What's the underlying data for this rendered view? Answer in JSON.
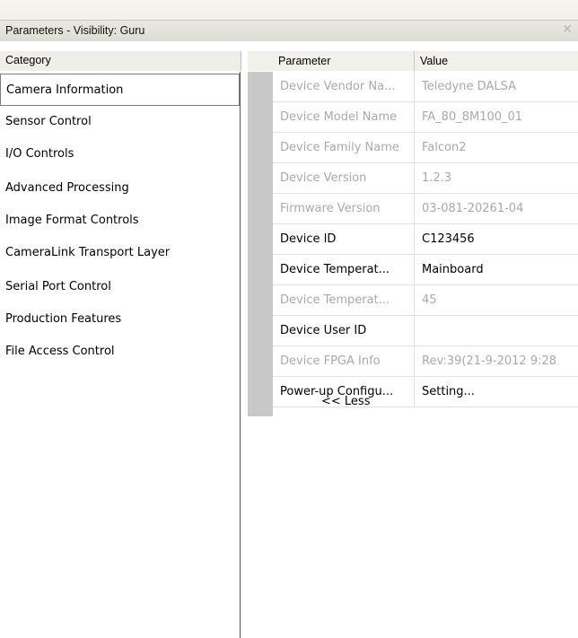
{
  "window": {
    "title": "Parameters - Visibility: Guru",
    "close_glyph": "✕"
  },
  "category_panel": {
    "header": "Category",
    "items": [
      "Camera Information",
      "Sensor Control",
      "I/O Controls",
      "Advanced Processing",
      "Image Format Controls",
      "CameraLink Transport Layer",
      "Serial Port Control",
      "Production Features",
      "File Access Control"
    ],
    "selected_index": 0
  },
  "parameter_grid": {
    "headers": [
      "Parameter",
      "Value"
    ],
    "rows": [
      {
        "parameter": "Device Vendor Na...",
        "value": "Teledyne DALSA",
        "enabled": false
      },
      {
        "parameter": "Device Model Name",
        "value": "FA_80_8M100_01",
        "enabled": false
      },
      {
        "parameter": "Device Family Name",
        "value": "Falcon2",
        "enabled": false
      },
      {
        "parameter": "Device Version",
        "value": "1.2.3",
        "enabled": false
      },
      {
        "parameter": "Firmware Version",
        "value": "03-081-20261-04",
        "enabled": false
      },
      {
        "parameter": "Device ID",
        "value": "C123456",
        "enabled": true
      },
      {
        "parameter": "Device Temperat...",
        "value": "Mainboard",
        "enabled": true
      },
      {
        "parameter": "Device Temperat...",
        "value": "45",
        "enabled": false
      },
      {
        "parameter": "Device User ID",
        "value": "",
        "enabled": true
      },
      {
        "parameter": "Device FPGA Info",
        "value": "Rev:39(21-9-2012 9:28",
        "enabled": false
      },
      {
        "parameter": "Power-up Configu...",
        "value": "Setting...",
        "enabled": true
      }
    ],
    "less_label": "<< Less"
  }
}
